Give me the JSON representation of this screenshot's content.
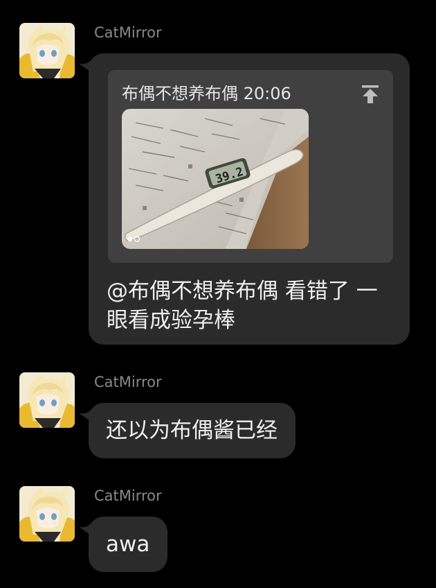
{
  "messages": [
    {
      "sender": "CatMirror",
      "reply": {
        "author": "布偶不想养布偶",
        "time": "20:06",
        "thermometer_reading": "39.2"
      },
      "text_line1": "@布偶不想养布偶 看错了 一",
      "text_line2": "眼看成验孕棒"
    },
    {
      "sender": "CatMirror",
      "text": "还以为布偶酱已经"
    },
    {
      "sender": "CatMirror",
      "text": "awa"
    }
  ],
  "colors": {
    "background": "#000000",
    "bubble": "#2b2b2b",
    "quote_card": "#404040",
    "sender_name": "#8a8a8a",
    "text": "#f0f0f0"
  },
  "icons": {
    "avatar": "anime-cat-girl-avatar",
    "jump": "jump-to-top-icon"
  }
}
